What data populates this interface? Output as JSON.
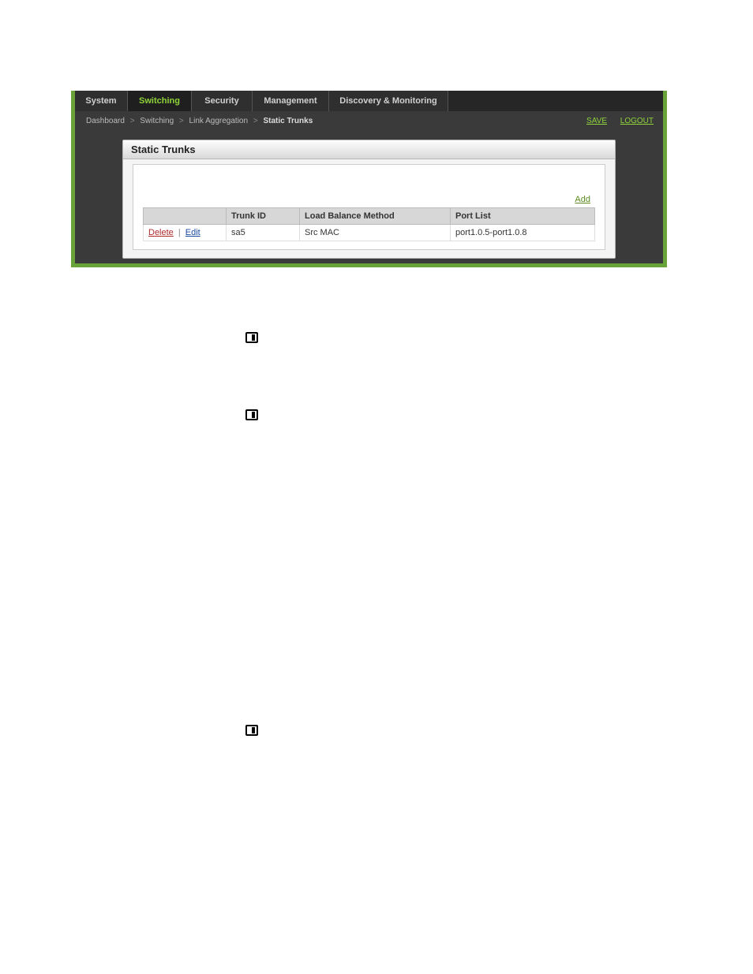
{
  "tabs": {
    "system": "System",
    "switching": "Switching",
    "security": "Security",
    "management": "Management",
    "discovery": "Discovery & Monitoring"
  },
  "breadcrumb": {
    "dashboard": "Dashboard",
    "switching": "Switching",
    "linkagg": "Link Aggregation",
    "current": "Static Trunks"
  },
  "actions": {
    "save": "SAVE",
    "logout": "LOGOUT"
  },
  "panel": {
    "title": "Static Trunks",
    "add": "Add"
  },
  "table": {
    "headers": {
      "trunk_id": "Trunk ID",
      "load_balance": "Load Balance Method",
      "port_list": "Port List"
    },
    "row": {
      "delete": "Delete",
      "edit": "Edit",
      "trunk_id": "sa5",
      "load_balance": "Src MAC",
      "port_list": "port1.0.5-port1.0.8"
    }
  }
}
